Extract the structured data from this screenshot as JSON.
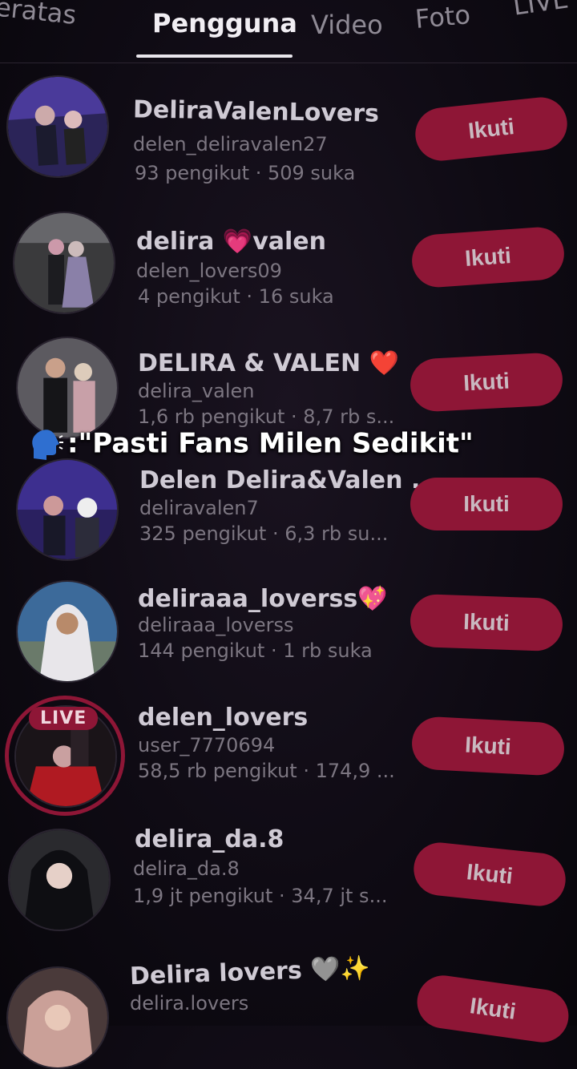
{
  "tabs": [
    {
      "label": "Teratas"
    },
    {
      "label": "Pengguna"
    },
    {
      "label": "Video"
    },
    {
      "label": "Foto"
    },
    {
      "label": "LIVE"
    }
  ],
  "caption": ":\"Pasti Fans Milen Sedikit\"",
  "follow_label": "Ikuti",
  "live_badge": "LIVE",
  "users": [
    {
      "name": "DeliraValenLovers",
      "handle": "delen_deliravalen27",
      "stats": "93 pengikut · 509 suka"
    },
    {
      "name": "delira 💗valen",
      "handle": "delen_lovers09",
      "stats": "4 pengikut · 16 suka"
    },
    {
      "name": "DELIRA & VALEN ❤️",
      "handle": "delira_valen",
      "stats": "1,6 rb pengikut · 8,7 rb s..."
    },
    {
      "name": "Delen Delira&Valen ...",
      "handle": "deliravalen7",
      "stats": "325 pengikut · 6,3 rb su..."
    },
    {
      "name": "deliraaa_loverss💖",
      "handle": "deliraaa_loverss",
      "stats": "144 pengikut · 1 rb suka"
    },
    {
      "name": "delen_lovers",
      "handle": "user_7770694",
      "stats": "58,5 rb pengikut · 174,9 ..."
    },
    {
      "name": "delira_da.8",
      "handle": "delira_da.8",
      "stats": "1,9 jt pengikut · 34,7 jt s..."
    },
    {
      "name": "Delira lovers 🩶✨",
      "handle": "delira.lovers",
      "stats": ""
    }
  ],
  "colors": {
    "accent": "#8e1636",
    "background": "#0f0b14"
  }
}
